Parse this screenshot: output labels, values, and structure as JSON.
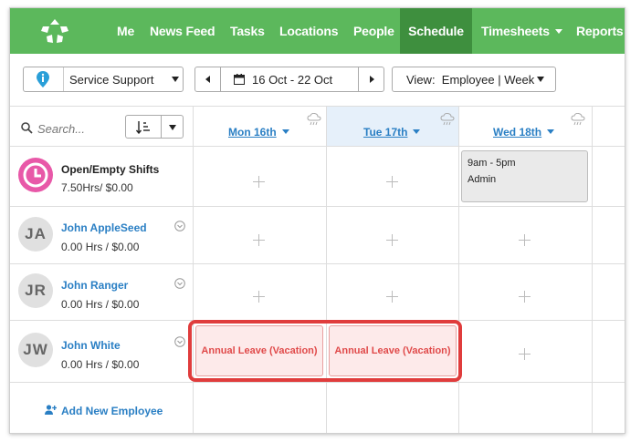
{
  "nav": {
    "items": [
      {
        "label": "Me"
      },
      {
        "label": "News Feed"
      },
      {
        "label": "Tasks"
      },
      {
        "label": "Locations"
      },
      {
        "label": "People"
      },
      {
        "label": "Schedule",
        "active": true
      },
      {
        "label": "Timesheets",
        "has_caret": true
      },
      {
        "label": "Reports"
      }
    ],
    "bg_color": "#5cb85c",
    "active_color": "#3e8f3e"
  },
  "toolbar": {
    "location": "Service Support",
    "date_range": "16 Oct - 22 Oct",
    "view_prefix": "View:",
    "view_value": "Employee | Week"
  },
  "grid": {
    "search_placeholder": "Search...",
    "days": [
      {
        "label": "Mon 16th"
      },
      {
        "label": "Tue 17th",
        "highlighted": true
      },
      {
        "label": "Wed 18th"
      }
    ],
    "rows": [
      {
        "name": "Open/Empty Shifts",
        "hours": "7.50Hrs/ $0.00",
        "avatar": "clock-icon"
      },
      {
        "name": "John AppleSeed",
        "hours": "0.00 Hrs / $0.00",
        "initials": "JA"
      },
      {
        "name": "John Ranger",
        "hours": "0.00 Hrs / $0.00",
        "initials": "JR"
      },
      {
        "name": "John White",
        "hours": "0.00 Hrs / $0.00",
        "initials": "JW"
      }
    ],
    "open_shift": {
      "time": "9am - 5pm",
      "role": "Admin"
    },
    "leave_label": "Annual Leave (Vacation)",
    "add_employee": "Add New Employee"
  },
  "colors": {
    "link": "#2a7fc4",
    "leave_text": "#e04a4a",
    "highlight_border": "#e03c3c"
  }
}
